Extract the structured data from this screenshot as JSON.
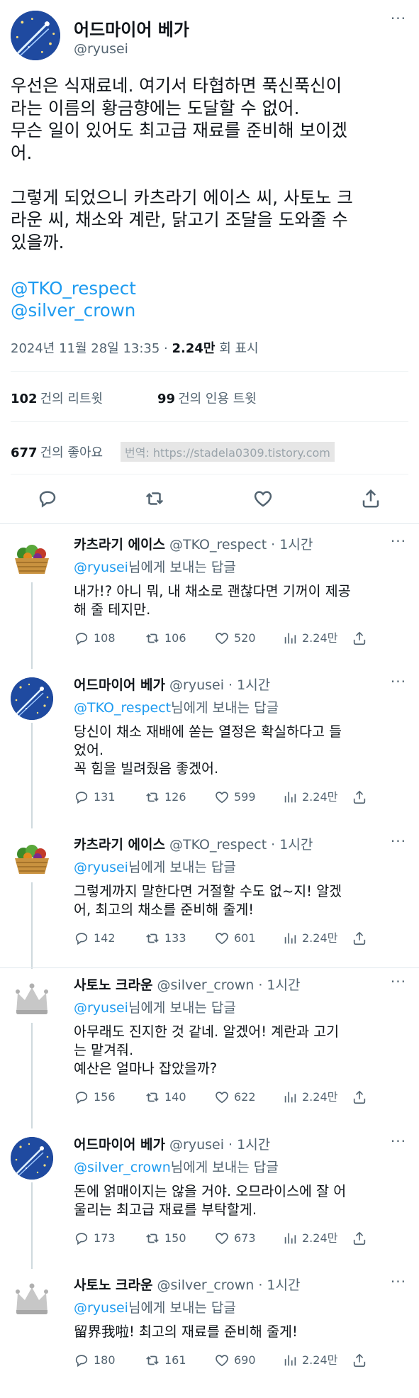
{
  "main_tweet": {
    "name": "어드마이어 베가",
    "handle": "@ryusei",
    "more": "···",
    "text": "우선은 식재료네. 여기서 타협하면 푹신푹신이\n라는 이름의 황금향에는 도달할 수 없어.\n무슨 일이 있어도 최고급 재료를 준비해 보이겠\n어.\n\n그렇게 되었으니 카츠라기 에이스 씨, 사토노 크\n라운 씨, 채소와 계란, 닭고기 조달을 도와줄 수\n있을까.",
    "mention1": "@TKO_respect",
    "mention2": "@silver_crown",
    "date": "2024년 11월 28일  13:35 · ",
    "views_count": "2.24만",
    "views_label": " 회 표시",
    "retweets_count": "102",
    "retweets_label": "건의 리트윗",
    "quotes_count": "99",
    "quotes_label": "건의 인용 트윗",
    "likes_count": "677",
    "likes_label": "건의 좋아요",
    "translate_watermark": "번역: https://stadela0309.tistory.com"
  },
  "replies": [
    {
      "name": "카츠라기 에이스",
      "handle": "@TKO_respect · 1시간",
      "to_handle": "@ryusei",
      "to_suffix": "님에게 보내는 답글",
      "text": "내가!? 아니 뭐, 내 채소로 괜찮다면 기꺼이 제공\n해 줄 테지만.",
      "reply_count": "108",
      "retweet_count": "106",
      "like_count": "520",
      "view_count": "2.24만",
      "avatar": "basket"
    },
    {
      "name": "어드마이어 베가",
      "handle": "@ryusei · 1시간",
      "to_handle": "@TKO_respect",
      "to_suffix": "님에게 보내는 답글",
      "text": "당신이 채소 재배에 쏟는 열정은 확실하다고 들\n었어.\n꼭 힘을 빌려줬음 좋겠어.",
      "reply_count": "131",
      "retweet_count": "126",
      "like_count": "599",
      "view_count": "2.24만",
      "avatar": "night-sky"
    },
    {
      "name": "카츠라기 에이스",
      "handle": "@TKO_respect · 1시간",
      "to_handle": "@ryusei",
      "to_suffix": "님에게 보내는 답글",
      "text": "그렇게까지 말한다면 거절할 수도 없~지! 알겠\n어, 최고의 채소를 준비해 줄게!",
      "reply_count": "142",
      "retweet_count": "133",
      "like_count": "601",
      "view_count": "2.24만",
      "avatar": "basket"
    },
    {
      "name": "사토노 크라운",
      "handle": "@silver_crown · 1시간",
      "to_handle": "@ryusei",
      "to_suffix": "님에게 보내는 답글",
      "text": "아무래도 진지한 것 같네. 알겠어! 계란과 고기\n는 맡겨줘.\n예산은 얼마나 잡았을까?",
      "reply_count": "156",
      "retweet_count": "140",
      "like_count": "622",
      "view_count": "2.24만",
      "avatar": "crown"
    },
    {
      "name": "어드마이어 베가",
      "handle": "@ryusei · 1시간",
      "to_handle": "@silver_crown",
      "to_suffix": "님에게 보내는 답글",
      "text": "돈에 얽매이지는 않을 거야. 오므라이스에 잘 어\n울리는 최고급 재료를 부탁할게.",
      "reply_count": "173",
      "retweet_count": "150",
      "like_count": "673",
      "view_count": "2.24만",
      "avatar": "night-sky"
    },
    {
      "name": "사토노 크라운",
      "handle": "@silver_crown · 1시간",
      "to_handle": "@ryusei",
      "to_suffix": "님에게 보내는 답글",
      "text": "留界我啦! 최고의 재료를 준비해 줄게!",
      "reply_count": "180",
      "retweet_count": "161",
      "like_count": "690",
      "view_count": "2.24만",
      "avatar": "crown"
    }
  ],
  "colors": {
    "link": "#1d9bf0",
    "muted": "#536471",
    "text": "#0f1419",
    "divider": "#eff3f4"
  }
}
